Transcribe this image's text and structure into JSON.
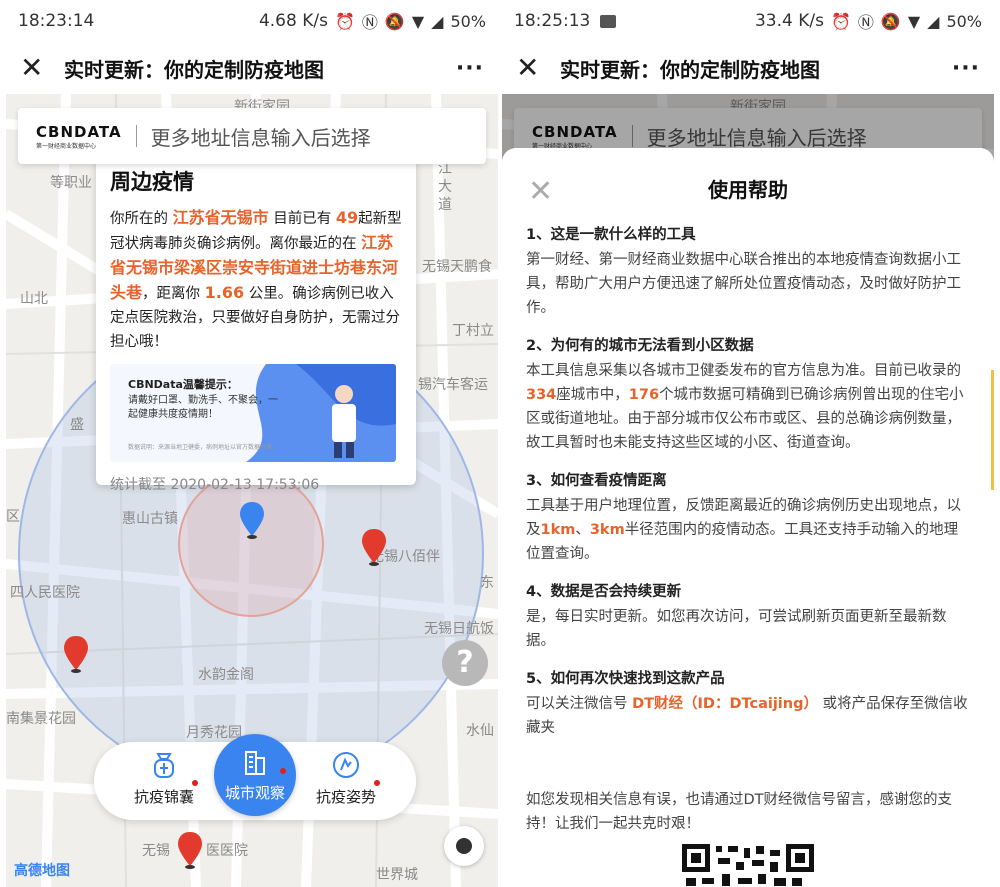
{
  "left": {
    "status": {
      "time": "18:23:14",
      "speed": "4.68 K/s",
      "battery": "50%"
    },
    "titlebar": {
      "close": "✕",
      "title": "实时更新：你的定制防疫地图",
      "more": "···"
    },
    "search": {
      "logo": "CBNDATA",
      "logo_sub": "第一财经商业数据中心",
      "placeholder": "更多地址信息输入后选择"
    },
    "popup": {
      "heading": "周边疫情",
      "p1": "你所在的",
      "province": "江苏省无锡市",
      "p2": "目前已有",
      "count": "49",
      "p3": "起新型冠状病毒肺炎确诊病例。离你最近的在",
      "location": "江苏省无锡市梁溪区崇安寺街道进士坊巷东河头巷",
      "p4": "，距离你",
      "distance": "1.66",
      "p5": "公里。确诊病例已收入定点医院救治，只要做好自身防护，无需过分担心哦！",
      "banner_title": "CBNData温馨提示：",
      "banner_text": "请戴好口罩、勤洗手、不聚会，一起健康共度疫情期！",
      "banner_note": "数据说明：来源当地卫健委，病例地址以官方数据为准。",
      "timestamp": "统计截至 2020-02-13 17:53:06"
    },
    "map_labels": {
      "l1": "新街家园",
      "l2": "等职业",
      "l3": "江",
      "l4": "大",
      "l5": "道",
      "l6": "无锡天鹏食",
      "l7": "山北",
      "l8": "丁村立",
      "l9": "锡汽车客运",
      "l10": "盛",
      "l11": "惠山古镇",
      "l12": "无锡八佰伴",
      "l13": "东",
      "l14": "四人民医院",
      "l15": "无锡日航饭",
      "l16": "水韵金阁",
      "l17": "南集景花园",
      "l18": "月秀花园",
      "l19": "水仙",
      "l20": "无锡",
      "l21": "医医院",
      "l22": "世界城",
      "l23": "区"
    },
    "nav": {
      "left": "抗疫锦囊",
      "center": "城市观察",
      "right": "抗疫姿势"
    },
    "help": "?",
    "amap": "高德地图"
  },
  "right": {
    "status": {
      "time": "18:25:13",
      "speed": "33.4 K/s",
      "battery": "50%"
    },
    "titlebar": {
      "close": "✕",
      "title": "实时更新：你的定制防疫地图",
      "more": "···"
    },
    "search": {
      "logo": "CBNDATA",
      "logo_sub": "第一财经商业数据中心",
      "placeholder": "更多地址信息输入后选择"
    },
    "map_label": "新街家园",
    "dialog": {
      "close": "✕",
      "title": "使用帮助",
      "s1_title": "1、这是一款什么样的工具",
      "s1_body": "第一财经、第一财经商业数据中心联合推出的本地疫情查询数据小工具，帮助广大用户方便迅速了解所处位置疫情动态，及时做好防护工作。",
      "s2_title": "2、为何有的城市无法看到小区数据",
      "s2_a": "本工具信息采集以各城市卫健委发布的官方信息为准。目前已收录的",
      "s2_n1": "334",
      "s2_b": "座城市中，",
      "s2_n2": "176",
      "s2_c": "个城市数据可精确到已确诊病例曾出现的住宅小区或街道地址。由于部分城市仅公布市或区、县的总确诊病例数量，故工具暂时也未能支持这些区域的小区、街道查询。",
      "s3_title": "3、如何查看疫情距离",
      "s3_a": "工具基于用户地理位置，反馈距离最近的确诊病例历史出现地点，以及",
      "s3_n1": "1km",
      "s3_b": "、",
      "s3_n2": "3km",
      "s3_c": "半径范围内的疫情动态。工具还支持手动输入的地理位置查询。",
      "s4_title": "4、数据是否会持续更新",
      "s4_body": "是，每日实时更新。如您再次访问，可尝试刷新页面更新至最新数据。",
      "s5_title": "5、如何再次快速找到这款产品",
      "s5_a": "可以关注微信号",
      "s5_n": "DT财经（ID：DTcaijing）",
      "s5_b": "或将产品保存至微信收藏夹",
      "footer": "如您发现相关信息有误，也请通过DT财经微信号留言，感谢您的支持！让我们一起共克时艰！"
    }
  },
  "colors": {
    "accent": "#3a84f0",
    "highlight": "#e8632b",
    "pin_red": "#e23b2e",
    "pin_blue": "#3a84f0"
  }
}
